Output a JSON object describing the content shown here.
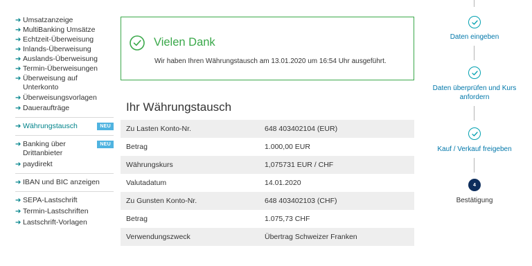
{
  "sidebar": {
    "group1": [
      {
        "label": "Umsatzanzeige"
      },
      {
        "label": "MultiBanking Umsätze"
      },
      {
        "label": "Echtzeit-Überweisung"
      },
      {
        "label": "Inlands-Überweisung"
      },
      {
        "label": "Auslands-Überweisung"
      },
      {
        "label": "Termin-Überweisungen"
      },
      {
        "label": "Überweisung auf Unterkonto"
      },
      {
        "label": "Überweisungsvorlagen"
      },
      {
        "label": "Daueraufträge"
      }
    ],
    "currency_exchange": {
      "label": "Währungstausch",
      "badge": "NEU"
    },
    "third_party": {
      "label": "Banking über Drittanbieter",
      "badge": "NEU"
    },
    "paydirekt": {
      "label": "paydirekt"
    },
    "iban_bic": {
      "label": "IBAN und BIC anzeigen"
    },
    "group2": [
      {
        "label": "SEPA-Lastschrift"
      },
      {
        "label": "Termin-Lastschriften"
      },
      {
        "label": "Lastschrift-Vorlagen"
      }
    ]
  },
  "success": {
    "title": "Vielen Dank",
    "message": "Wir haben Ihren Währungstausch am 13.01.2020 um 16:54 Uhr ausgeführt."
  },
  "summary": {
    "title": "Ihr Währungstausch",
    "rows": [
      {
        "label": "Zu Lasten Konto-Nr.",
        "value": "648 403402104 (EUR)"
      },
      {
        "label": "Betrag",
        "value": "1.000,00 EUR"
      },
      {
        "label": "Währungskurs",
        "value": "1,075731 EUR / CHF"
      },
      {
        "label": "Valutadatum",
        "value": "14.01.2020"
      },
      {
        "label": "Zu Gunsten Konto-Nr.",
        "value": "648 403402103 (CHF)"
      },
      {
        "label": "Betrag",
        "value": "1.075,73 CHF"
      },
      {
        "label": "Verwendungszweck",
        "value": "Übertrag Schweizer Franken"
      }
    ]
  },
  "steps": [
    {
      "label": "Daten eingeben"
    },
    {
      "label": "Daten überprüfen und Kurs anfordern"
    },
    {
      "label": "Kauf / Verkauf freigeben"
    },
    {
      "number": "4",
      "label": "Bestätigung"
    }
  ],
  "colors": {
    "accent": "#00838a",
    "success": "#3aa84a",
    "step_active": "#0d2d5c",
    "badge": "#4fb3e0"
  }
}
